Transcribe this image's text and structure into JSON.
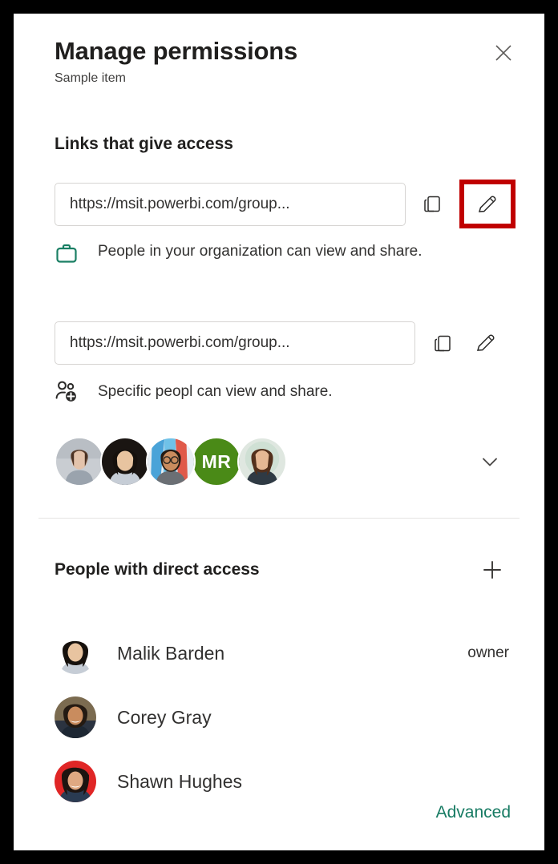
{
  "dialog": {
    "title": "Manage permissions",
    "subtitle": "Sample item",
    "close_icon": "close-icon"
  },
  "links_section": {
    "heading": "Links that give access",
    "links": [
      {
        "url": "https://msit.powerbi.com/group...",
        "copy_icon": "copy-icon",
        "edit_icon": "pencil-icon",
        "edit_highlighted": true,
        "permission_icon": "briefcase-icon",
        "permission_text": "People in your organization can view and share."
      },
      {
        "url": "https://msit.powerbi.com/group...",
        "copy_icon": "copy-icon",
        "edit_icon": "pencil-icon",
        "edit_highlighted": false,
        "permission_icon": "people-add-icon",
        "permission_text": "Specific peopl can view and share."
      }
    ],
    "avatars": [
      {
        "type": "photo",
        "skin": "#e3c3ab",
        "hair": "#5a3d2b",
        "bg": "#c9cdd2"
      },
      {
        "type": "photo",
        "skin": "#e8c4a0",
        "hair": "#16110d",
        "bg": "#1a1512"
      },
      {
        "type": "photo",
        "skin": "#c98c5e",
        "hair": "#241a12",
        "bg": "#4aa3d8"
      },
      {
        "type": "initials",
        "initials": "MR",
        "color": "#4A8A17"
      },
      {
        "type": "photo",
        "skin": "#e6b894",
        "hair": "#53301c",
        "bg": "#dfe7e0"
      }
    ],
    "expand_icon": "chevron-down-icon"
  },
  "direct_access": {
    "heading": "People with direct access",
    "add_icon": "plus-icon",
    "people": [
      {
        "name": "Malik Barden",
        "role": "owner",
        "skin": "#e8c4a0",
        "hair": "#16110d",
        "bg": "#16110d"
      },
      {
        "name": "Corey Gray",
        "role": "",
        "skin": "#c98c5e",
        "hair": "#241a12",
        "bg": "#7b6b50"
      },
      {
        "name": "Shawn Hughes",
        "role": "",
        "skin": "#e0a882",
        "hair": "#1d1410",
        "bg": "#e02626"
      }
    ],
    "advanced_label": "Advanced"
  },
  "colors": {
    "accent_green": "#177B63",
    "highlight_red": "#C00000",
    "initials_green": "#4A8A17",
    "text_primary": "#201f1e",
    "border": "#d6d4d2"
  }
}
